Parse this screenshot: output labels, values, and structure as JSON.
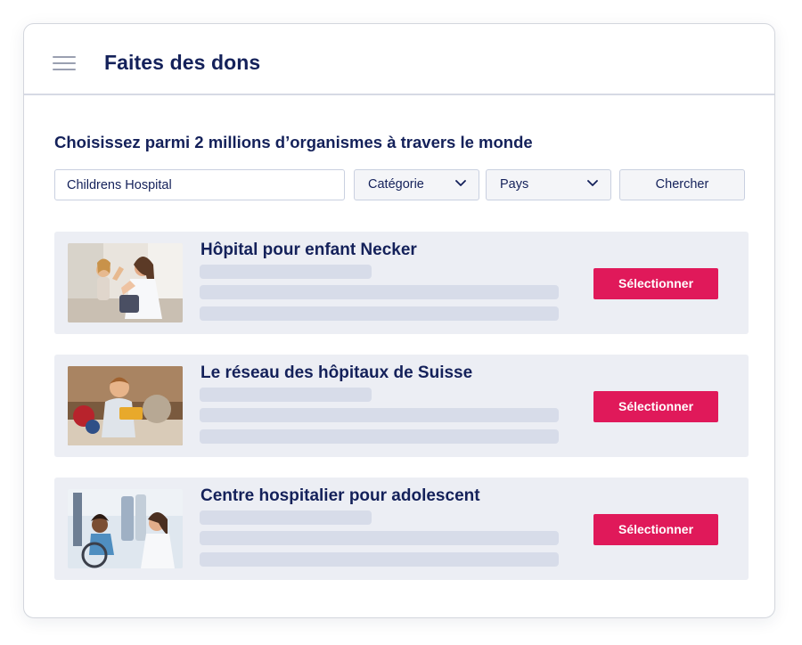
{
  "header": {
    "title": "Faites des dons",
    "menu_icon": "hamburger-menu-icon"
  },
  "search": {
    "headline": "Choisissez parmi 2 millions d’organismes à travers le monde",
    "query_value": "Childrens Hospital",
    "category_label": "Catégorie",
    "country_label": "Pays",
    "search_button": "Chercher",
    "dropdown_icon": "chevron-down-icon"
  },
  "results": [
    {
      "name": "Hôpital pour enfant Necker",
      "button": "Sélectionner",
      "image": "child-high-five-doctor-photo"
    },
    {
      "name": "Le réseau des hôpitaux de Suisse",
      "button": "Sélectionner",
      "image": "child-playing-toys-photo"
    },
    {
      "name": "Centre hospitalier pour adolescent",
      "button": "Sélectionner",
      "image": "teen-wheelchair-doctor-photo"
    }
  ],
  "colors": {
    "accent": "#e0195a",
    "text": "#14215a",
    "card_bg": "#eceef4",
    "skeleton": "#d7dce9"
  }
}
